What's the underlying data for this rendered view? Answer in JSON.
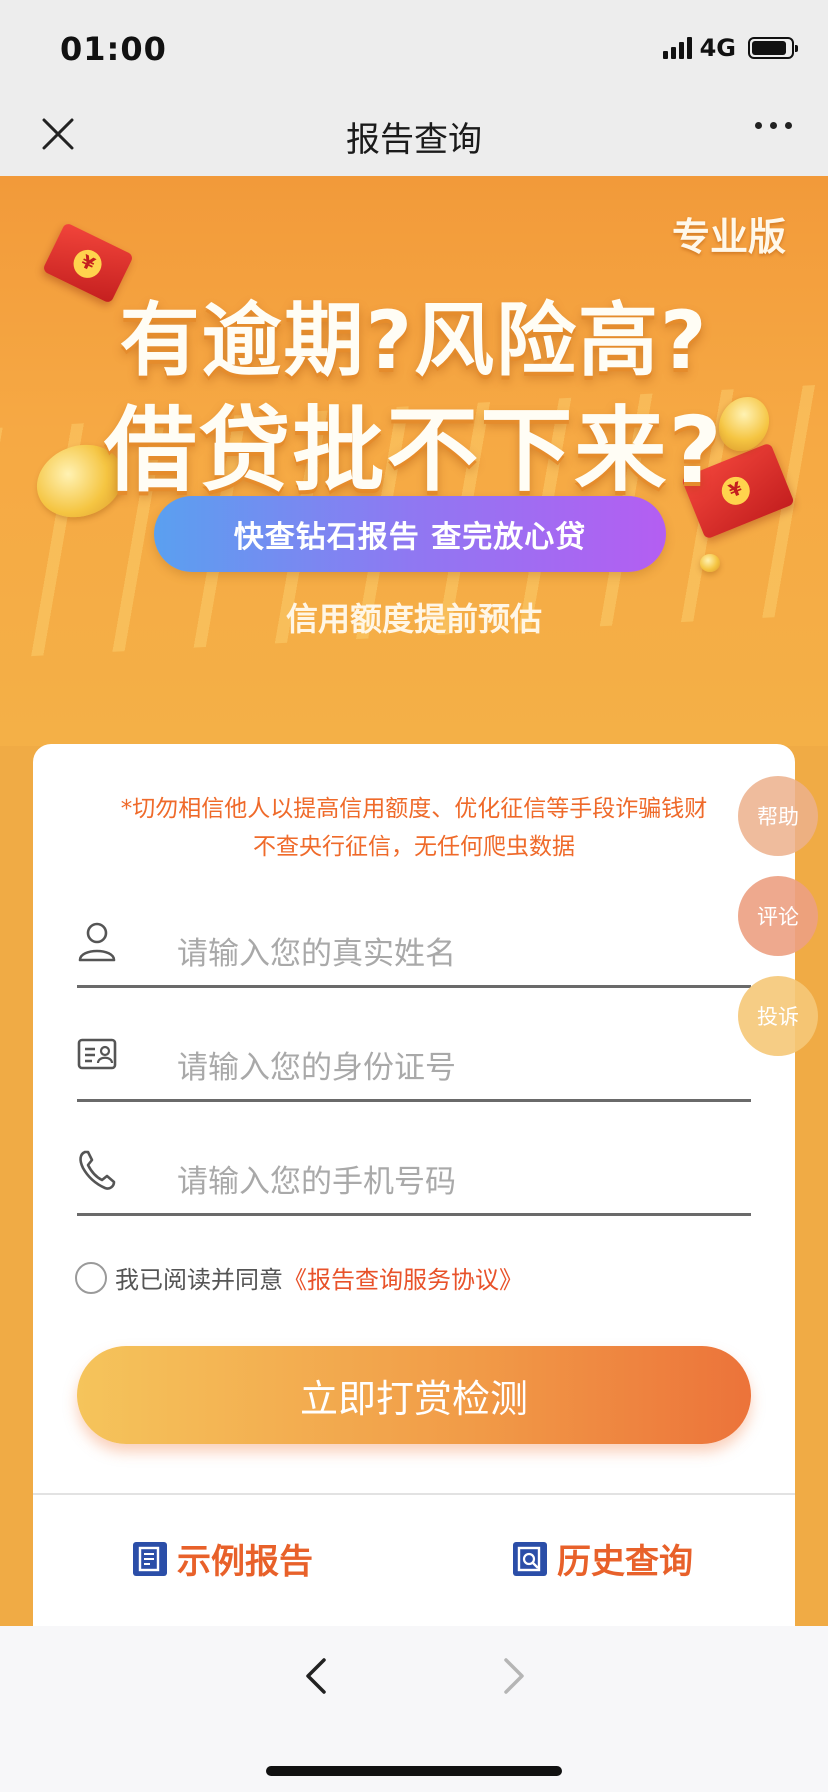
{
  "status_bar": {
    "time": "01:00",
    "network": "4G"
  },
  "nav": {
    "title": "报告查询"
  },
  "banner": {
    "tag": "专业版",
    "headline_1": "有逾期?风险高?",
    "headline_2": "借贷批不下来?",
    "pill_text": "快查钻石报告  查完放心贷",
    "slogan": "信用额度提前预估",
    "currency_symbol": "¥"
  },
  "form": {
    "warning_line_1": "*切勿相信他人以提高信用额度、优化征信等手段诈骗钱财",
    "warning_line_2": "不查央行征信，无任何爬虫数据",
    "name_placeholder": "请输入您的真实姓名",
    "id_placeholder": "请输入您的身份证号",
    "phone_placeholder": "请输入您的手机号码",
    "agree_text": "我已阅读并同意",
    "agree_link": "《报告查询服务协议》",
    "submit_label": "立即打赏检测"
  },
  "links": {
    "sample_report": "示例报告",
    "history_query": "历史查询"
  },
  "side_buttons": {
    "help": "帮助",
    "review": "评论",
    "complain": "投诉"
  },
  "colors": {
    "accent_orange": "#ef6a2a",
    "link_red": "#e8522a",
    "banner_bg": "#f6a944"
  },
  "icons": [
    "close-icon",
    "more-icon",
    "user-icon",
    "id-card-icon",
    "phone-icon",
    "report-icon",
    "search-doc-icon",
    "back-icon",
    "forward-icon"
  ]
}
